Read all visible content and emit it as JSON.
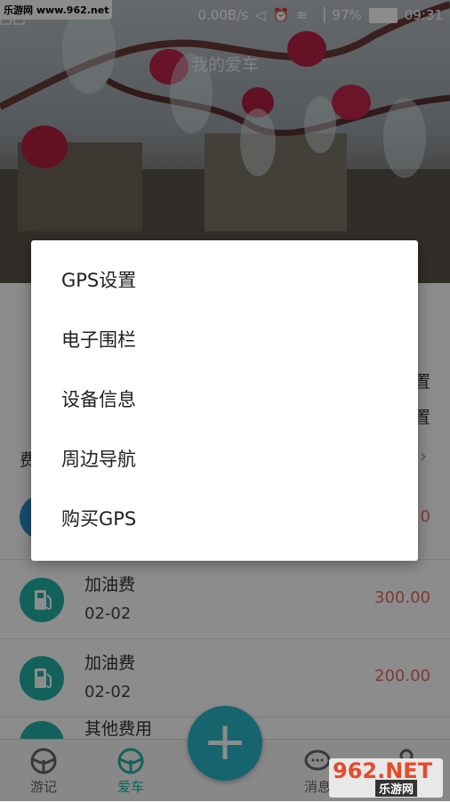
{
  "watermark_top": "乐游网 www.962.net",
  "status_bar": {
    "network_speed": "0.00B/s",
    "battery": "97%",
    "time": "09:31"
  },
  "hero": {
    "title": "我的爱车"
  },
  "partial_text": {
    "right_1": "置",
    "right_2": "置",
    "left_label": "费"
  },
  "records": [
    {
      "name": "加油费",
      "date": "02-02",
      "amount": "300.00"
    },
    {
      "name": "加油费",
      "date": "02-02",
      "amount": "200.00"
    },
    {
      "name": "其他费用",
      "date": "",
      "amount": ""
    }
  ],
  "first_row_amount_partial": "0",
  "bottom_nav": {
    "items": [
      {
        "label": "游记"
      },
      {
        "label": "爱车"
      },
      {
        "label": "消息"
      }
    ]
  },
  "menu": {
    "items": [
      {
        "label": "GPS设置"
      },
      {
        "label": "电子围栏"
      },
      {
        "label": "设备信息"
      },
      {
        "label": "周边导航"
      },
      {
        "label": "购买GPS"
      }
    ]
  },
  "logo": {
    "text_big": "962.NET",
    "text_small": "乐游网"
  },
  "colors": {
    "accent": "#21b3a6",
    "fab": "#29b9c8",
    "amount": "#e56a6a"
  }
}
